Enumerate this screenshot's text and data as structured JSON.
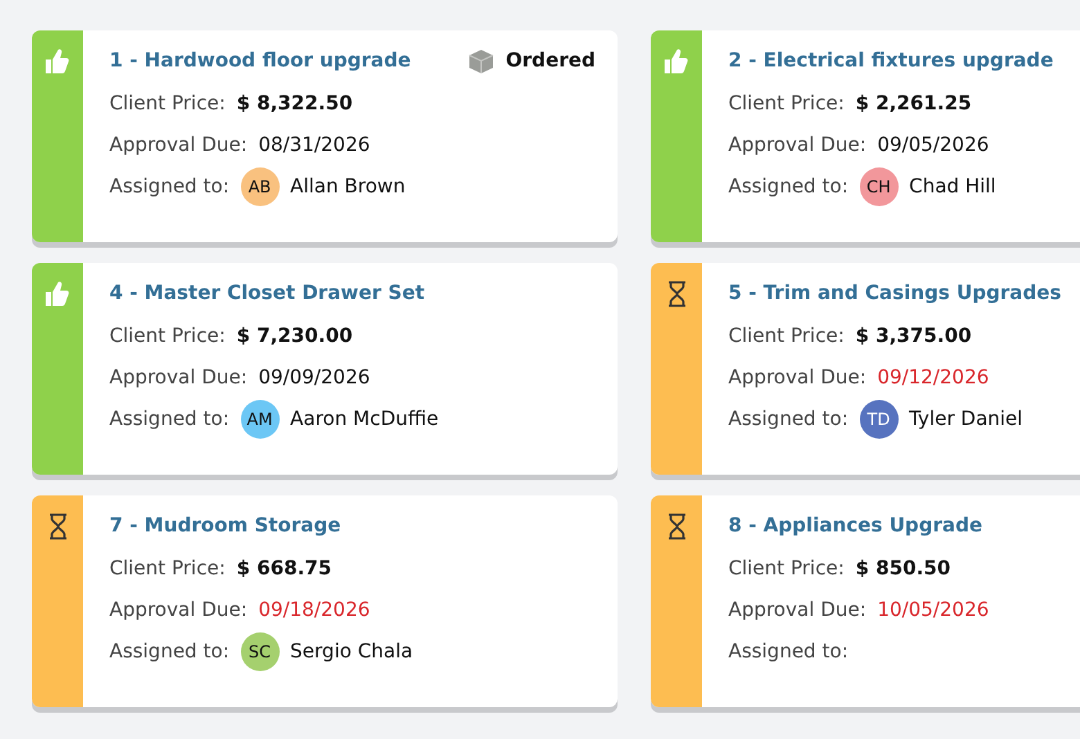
{
  "cards": [
    {
      "kind": "approved",
      "title": "1 - Hardwood floor upgrade",
      "badge": "Ordered",
      "price_label": "Client Price:",
      "price": "$ 8,322.50",
      "due_label": "Approval Due:",
      "due": "08/31/2026",
      "overdue": false,
      "assigned_label": "Assigned to:",
      "assignee": {
        "initials": "AB",
        "name": "Allan Brown",
        "color": "#f9c17f"
      }
    },
    {
      "kind": "approved",
      "title": "2 - Electrical fixtures upgrade",
      "price_label": "Client Price:",
      "price": "$ 2,261.25",
      "due_label": "Approval Due:",
      "due": "09/05/2026",
      "overdue": false,
      "assigned_label": "Assigned to:",
      "assignee": {
        "initials": "CH",
        "name": "Chad Hill",
        "color": "#f2979b"
      }
    },
    {
      "kind": "approved",
      "title": "4 - Master Closet Drawer Set",
      "price_label": "Client Price:",
      "price": "$ 7,230.00",
      "due_label": "Approval Due:",
      "due": "09/09/2026",
      "overdue": false,
      "assigned_label": "Assigned to:",
      "assignee": {
        "initials": "AM",
        "name": "Aaron McDuffie",
        "color": "#6cc7f5"
      }
    },
    {
      "kind": "pending",
      "title": "5 - Trim and Casings Upgrades",
      "price_label": "Client Price:",
      "price": "$ 3,375.00",
      "due_label": "Approval Due:",
      "due": "09/12/2026",
      "overdue": true,
      "assigned_label": "Assigned to:",
      "assignee": {
        "initials": "TD",
        "name": "Tyler Daniel",
        "color": "#5773bf"
      }
    },
    {
      "kind": "pending",
      "title": "7 - Mudroom Storage",
      "price_label": "Client Price:",
      "price": "$ 668.75",
      "due_label": "Approval Due:",
      "due": "09/18/2026",
      "overdue": true,
      "assigned_label": "Assigned to:",
      "assignee": {
        "initials": "SC",
        "name": "Sergio Chala",
        "color": "#a5d06e"
      }
    },
    {
      "kind": "pending",
      "title": "8 - Appliances Upgrade",
      "price_label": "Client Price:",
      "price": "$ 850.50",
      "due_label": "Approval Due:",
      "due": "10/05/2026",
      "overdue": true,
      "assigned_label": "Assigned to:"
    }
  ]
}
